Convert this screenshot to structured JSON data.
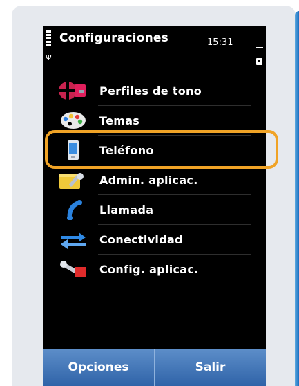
{
  "status_bar": {
    "title": "Configuraciones",
    "time": "15:31"
  },
  "menu": {
    "items": [
      {
        "label": "Perfiles de tono",
        "icon": "profiles-icon"
      },
      {
        "label": "Temas",
        "icon": "palette-icon"
      },
      {
        "label": "Teléfono",
        "icon": "phone-device-icon"
      },
      {
        "label": "Admin. aplicac.",
        "icon": "app-manager-icon"
      },
      {
        "label": "Llamada",
        "icon": "call-handset-icon"
      },
      {
        "label": "Conectividad",
        "icon": "connectivity-arrows-icon"
      },
      {
        "label": "Config. aplicac.",
        "icon": "app-settings-tools-icon"
      }
    ],
    "highlighted_item": "Teléfono"
  },
  "softkeys": {
    "left": "Opciones",
    "right": "Salir"
  },
  "colors": {
    "highlight_ring": "#f0a326",
    "softkey_bar": "#3f73b6",
    "screen_bg": "#000000"
  }
}
